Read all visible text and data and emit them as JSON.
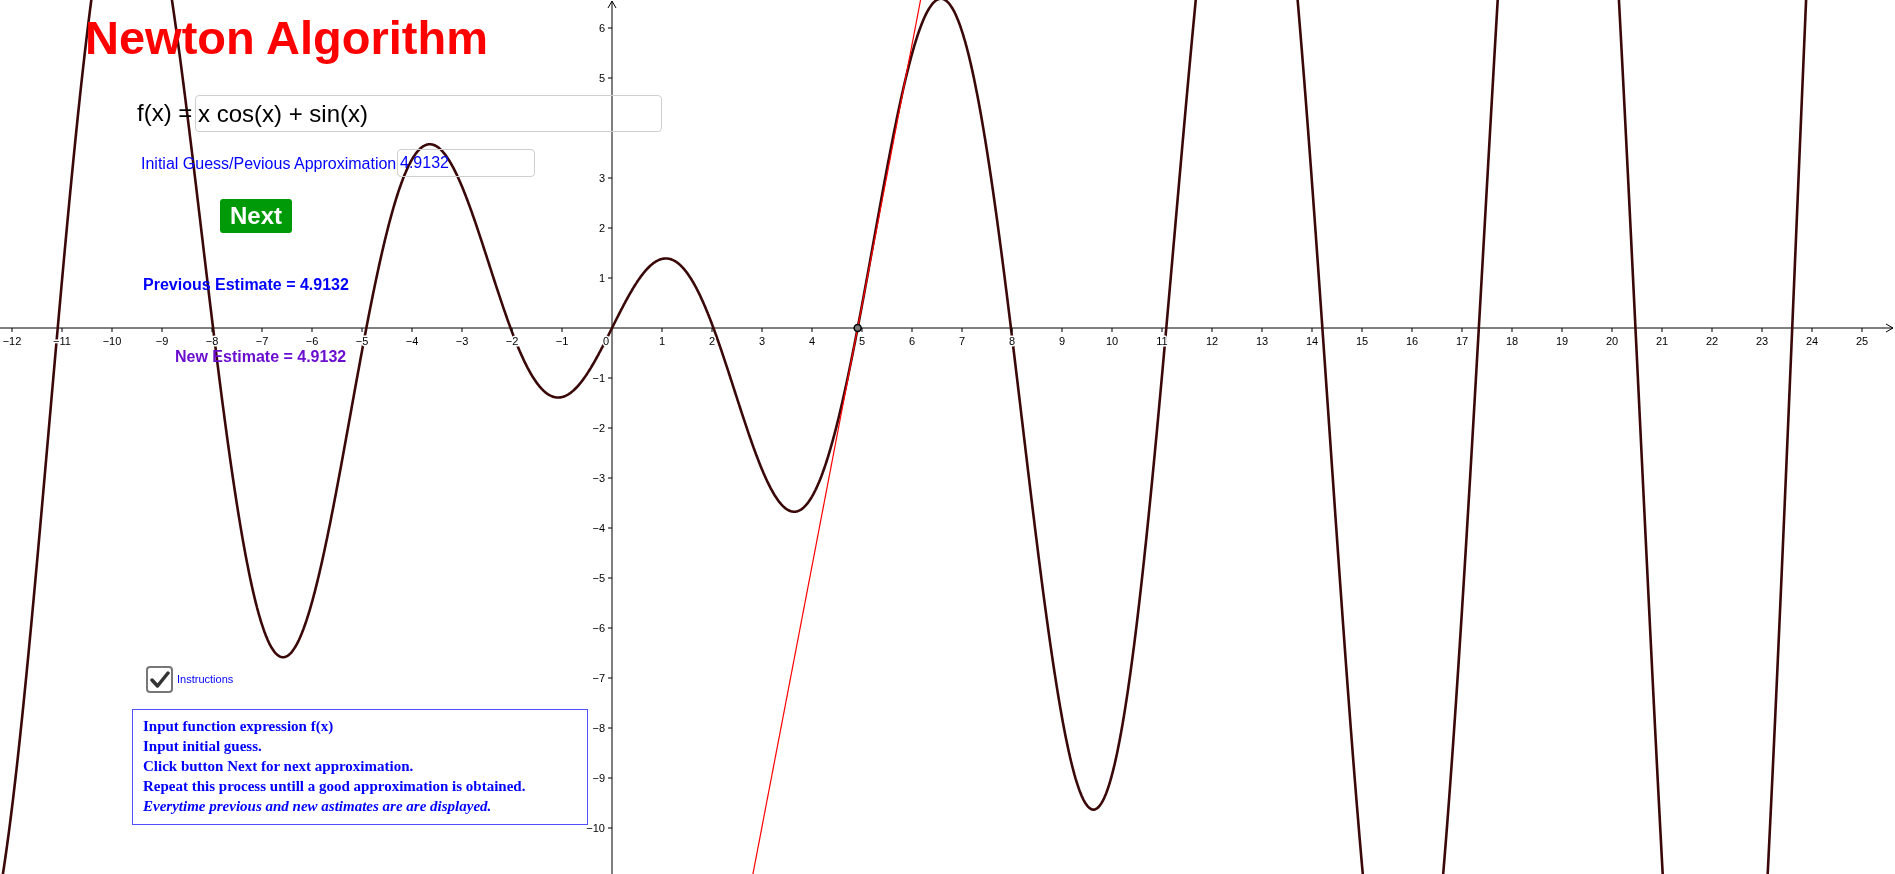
{
  "title": "Newton Algorithm",
  "function_input": {
    "label": "f(x) =",
    "value": "x cos(x) + sin(x)"
  },
  "guess_input": {
    "label": "Initial Guess/Pevious Approximation",
    "value": "4.9132"
  },
  "next_button": {
    "label": "Next"
  },
  "previous_estimate": "Previous Estimate = 4.9132",
  "new_estimate": "New Estimate = 4.9132",
  "instructions_checkbox": {
    "label": "Instructions",
    "checked": true
  },
  "instructions": [
    {
      "kind": "plain",
      "text": "Input function expression f(x)"
    },
    {
      "kind": "plain",
      "text": "Input initial guess."
    },
    {
      "kind": "plain",
      "text": "Click button Next for next approximation."
    },
    {
      "kind": "plain",
      "text": "Repeat this process untill a good approximation is obtained."
    },
    {
      "kind": "italic",
      "text": "Everytime previous and new astimates are are displayed."
    }
  ],
  "graph": {
    "x_tick_labels": [
      "−12",
      "−11",
      "−10",
      "−9",
      "−8",
      "−7",
      "−6",
      "−5",
      "−4",
      "−3",
      "−2",
      "−1",
      "0",
      "1",
      "2",
      "3",
      "4",
      "5",
      "6",
      "7",
      "8",
      "9",
      "10",
      "11",
      "12",
      "13",
      "14",
      "15",
      "16",
      "17",
      "18",
      "19",
      "20",
      "21",
      "22",
      "23",
      "24",
      "25"
    ],
    "y_tick_labels": [
      "6",
      "5",
      "3",
      "2",
      "1",
      "−1",
      "−2",
      "−3",
      "−4",
      "−5",
      "−6",
      "−7",
      "−8",
      "−9",
      "−10"
    ]
  }
}
